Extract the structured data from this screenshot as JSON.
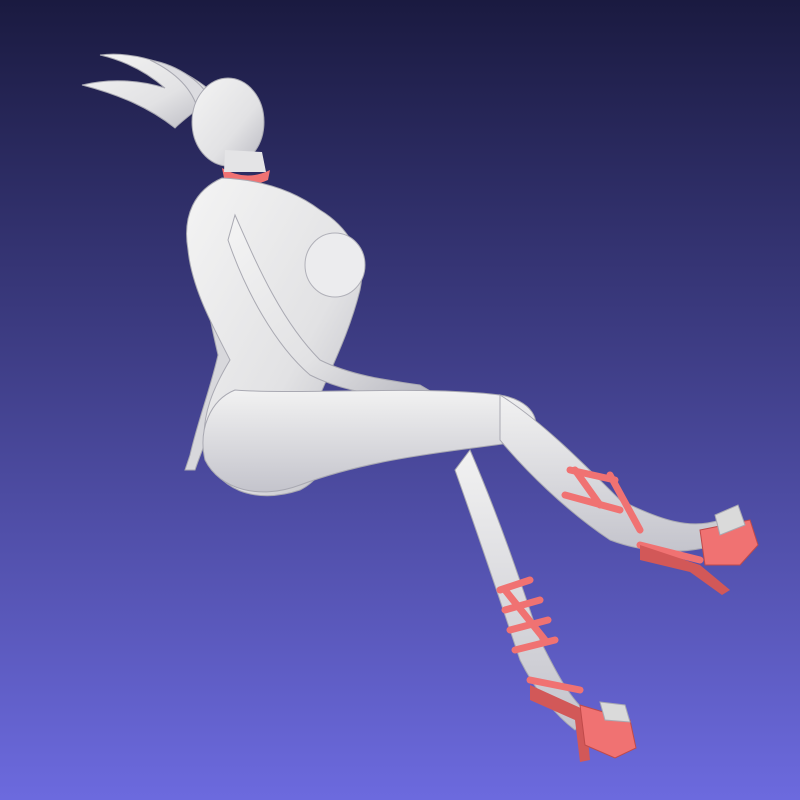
{
  "app": {
    "view": "3d-mesh-viewport",
    "background": {
      "top_color": "#1a1a40",
      "bottom_color": "#6c6ade"
    },
    "model": {
      "body_color": "#e9e9e9",
      "shadow_color": "#9c9ca8",
      "accent_color": "#f07272",
      "accent_dark": "#d25858"
    }
  }
}
